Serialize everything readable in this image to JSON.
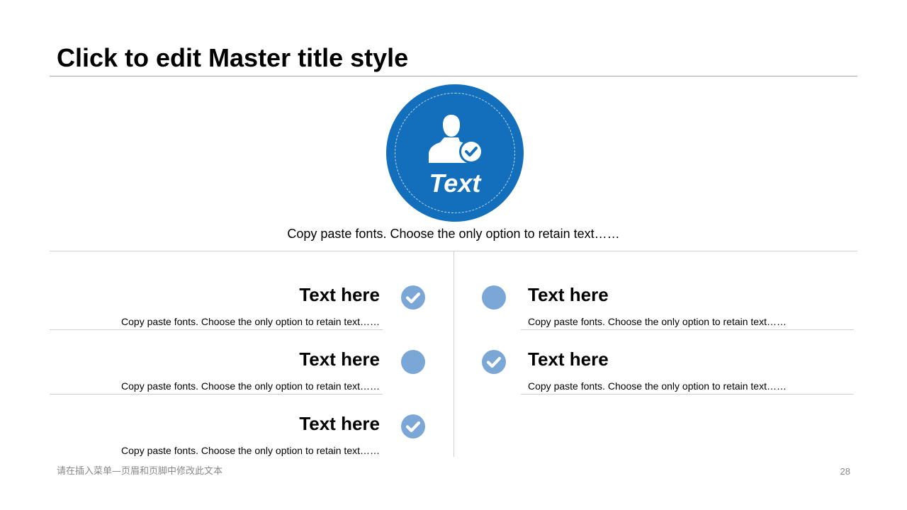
{
  "slide": {
    "title": "Click to edit Master title style",
    "accent_color": "#136fbb",
    "marker_color": "#7aa7d6"
  },
  "hero": {
    "icon": "user-check-icon",
    "label": "Text",
    "caption": "Copy paste fonts. Choose the only option to retain text……"
  },
  "left_items": [
    {
      "heading": "Text here",
      "text": "Copy paste fonts. Choose the only option to retain text……",
      "marker": "checked"
    },
    {
      "heading": "Text here",
      "text": "Copy paste fonts. Choose the only option to retain text……",
      "marker": "empty"
    },
    {
      "heading": "Text here",
      "text": "Copy paste fonts. Choose the only option to retain text……",
      "marker": "checked"
    }
  ],
  "right_items": [
    {
      "heading": "Text here",
      "text": "Copy paste fonts. Choose the only option to retain text……",
      "marker": "empty"
    },
    {
      "heading": "Text here",
      "text": "Copy paste fonts. Choose the only option to retain text……",
      "marker": "checked"
    }
  ],
  "footer": {
    "text": "请在插入菜单—页眉和页脚中修改此文本",
    "page_number": "28"
  }
}
